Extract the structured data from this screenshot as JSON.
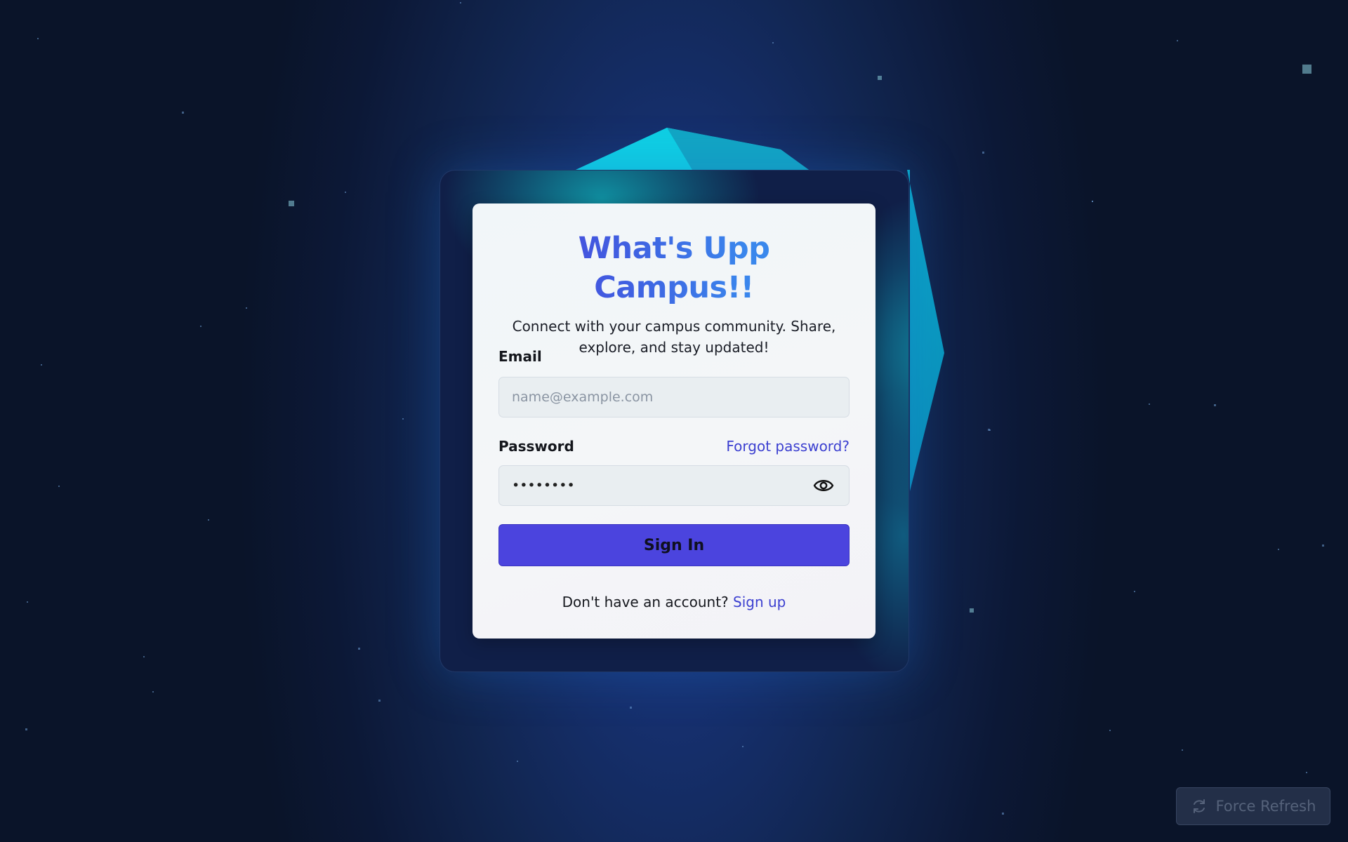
{
  "login_card": {
    "title": "What's Upp Campus!!",
    "subtitle": "Connect with your campus community. Share, explore, and stay updated!",
    "email": {
      "label": "Email",
      "placeholder": "name@example.com",
      "value": ""
    },
    "password": {
      "label": "Password",
      "forgot_label": "Forgot password?",
      "masked_value": "••••••••",
      "toggle_icon": "eye-icon"
    },
    "sign_in_label": "Sign In",
    "signup_prompt": "Don't have an account?",
    "signup_link": "Sign up"
  },
  "force_refresh": {
    "label": "Force Refresh",
    "icon": "refresh-icon"
  },
  "colors": {
    "primary": "#4b44de",
    "link": "#3b3fd0",
    "accent_teal": "#0fc3d6",
    "background_dark": "#0a1429"
  }
}
